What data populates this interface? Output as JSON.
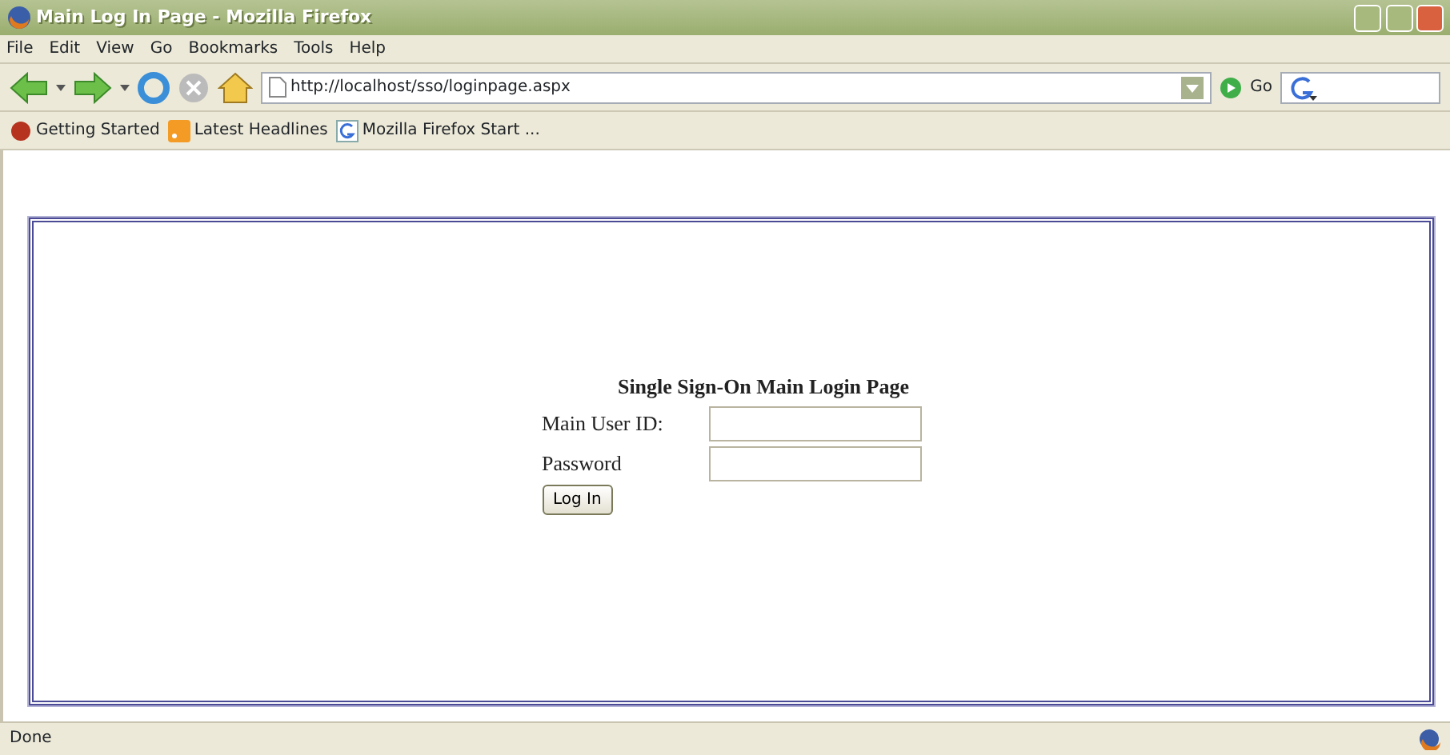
{
  "window": {
    "title": "Main Log In Page - Mozilla Firefox"
  },
  "menu": [
    "File",
    "Edit",
    "View",
    "Go",
    "Bookmarks",
    "Tools",
    "Help"
  ],
  "address_bar": {
    "url": "http://localhost/sso/loginpage.aspx",
    "go_label": "Go"
  },
  "bookmarks": [
    {
      "label": "Getting Started",
      "kind": "start"
    },
    {
      "label": "Latest Headlines",
      "kind": "feed"
    },
    {
      "label": "Mozilla Firefox Start ...",
      "kind": "google"
    }
  ],
  "form": {
    "title": "Single Sign-On Main Login Page",
    "fields": [
      {
        "label": "Main User ID:"
      },
      {
        "label": "Password"
      }
    ],
    "button": "Log In"
  },
  "status_bar": {
    "text": "Done"
  }
}
